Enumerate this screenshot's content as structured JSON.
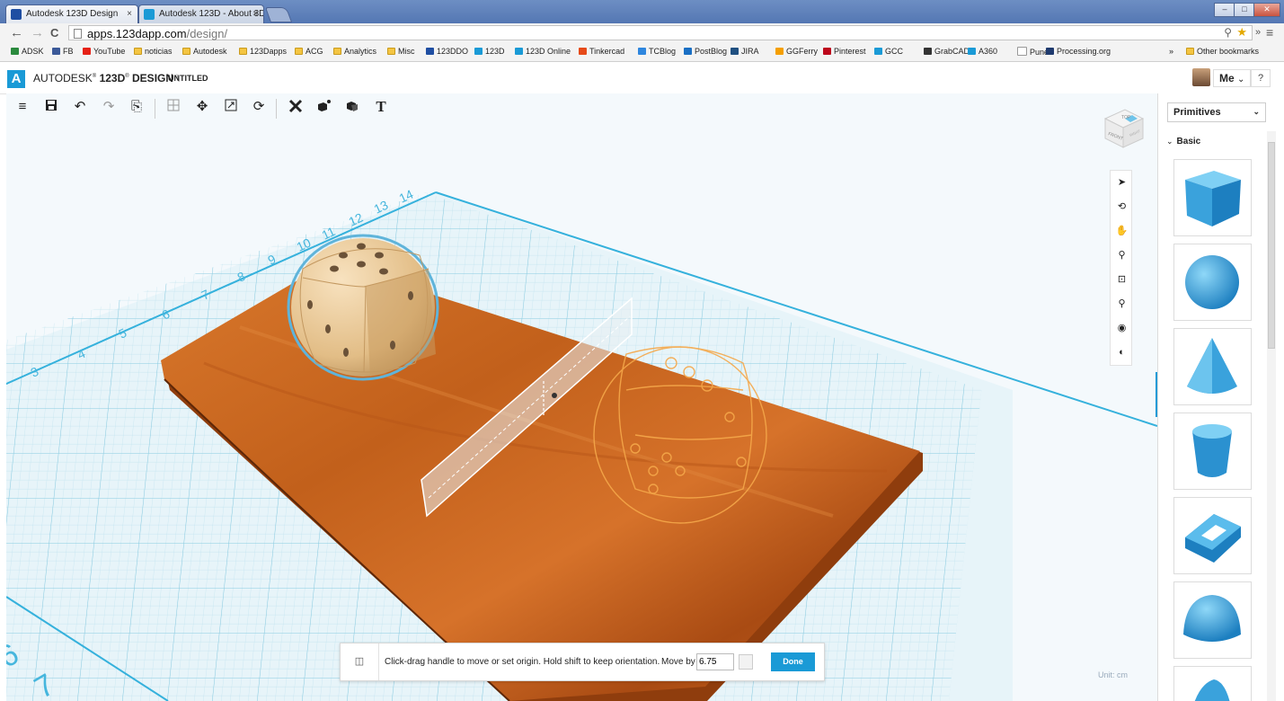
{
  "browser": {
    "tabs": [
      {
        "label": "Autodesk 123D Design",
        "close": "×"
      },
      {
        "label": "Autodesk 123D - About 3D",
        "close": "×"
      }
    ],
    "window_controls": {
      "minimize": "–",
      "maximize": "□",
      "close": "✕"
    },
    "url_domain": "apps.123dapp.com",
    "url_path": "/design/",
    "nav": {
      "back": "←",
      "forward": "→",
      "reload": "C"
    },
    "bookmarks": [
      "ADSK",
      "FB",
      "YouTube",
      "noticias",
      "Autodesk",
      "123Dapps",
      "ACG",
      "Analytics",
      "Misc",
      "123DDO",
      "123D",
      "123D Online",
      "Tinkercad",
      "TCBlog",
      "PostBlog",
      "JIRA",
      "GGFerry",
      "Pinterest",
      "GCC",
      "GrabCAD",
      "A360",
      "Pune",
      "Processing.org"
    ],
    "bookmarks_overflow": "»",
    "other_bookmarks": "Other bookmarks"
  },
  "app": {
    "logo": "A",
    "brand_prefix": "AUTODESK",
    "brand_suffix": "123D",
    "brand_product": "DESIGN",
    "separator": "\\",
    "document_title": "UNTITLED",
    "user_label": "Me",
    "user_caret": "⌄",
    "help": "?"
  },
  "toolbar": {
    "menu": "≡",
    "undo": "↶",
    "redo": "↷",
    "clipboard": "⎘",
    "move": "✥",
    "rotate": "⟳",
    "text": "T"
  },
  "viewcube": {
    "top": "TOP",
    "front": "FRONT",
    "right": "RIGHT"
  },
  "ruler_labels": [
    "3",
    "4",
    "5",
    "6",
    "7",
    "8",
    "9",
    "10",
    "11",
    "12",
    "13",
    "14"
  ],
  "ruler_big_labels": [
    "6",
    "7"
  ],
  "bottom_panel": {
    "message": "Click-drag handle to move or set origin. Hold shift to keep orientation.",
    "move_by_label": "Move by",
    "move_by_value": "6.75",
    "done_label": "Done"
  },
  "units_label": "Unit: cm",
  "side_panel": {
    "dropdown": "Primitives",
    "section": "Basic",
    "primitives": [
      "box",
      "sphere",
      "cone",
      "cylinder",
      "torus",
      "hemisphere",
      "paraboloid"
    ]
  },
  "colors": {
    "accent": "#1a9ad6",
    "grid": "#aedceb",
    "wood": "#c8621d",
    "die": "#e8c592",
    "ghost": "#f5a84a"
  }
}
